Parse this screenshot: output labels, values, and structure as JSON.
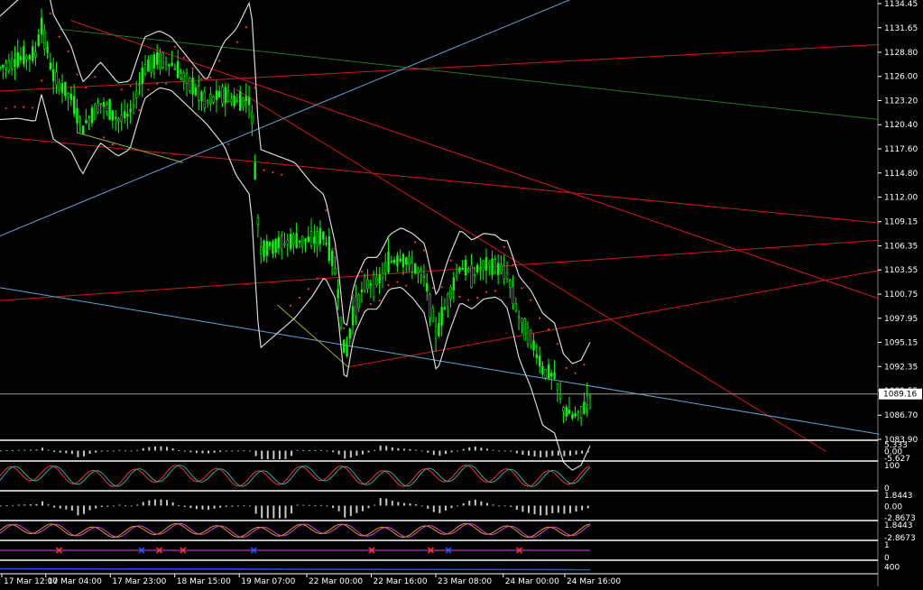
{
  "colors": {
    "background": "#000000",
    "candle": "#00ff00",
    "candle_outline": "#ffffff",
    "bands": "#d8d8d8",
    "psar": "#ff3030",
    "trend_red": "#d01818",
    "trend_blue": "#5ea6d8",
    "trend_green": "#1f7a1f",
    "trend_olive": "#a0b020",
    "trend_magenta": "#ff40a0",
    "axis_text": "#ffffff",
    "price_label_bg": "#ffffff",
    "price_label_text": "#000000",
    "osc_gray": "#c8c8c8",
    "osc_red": "#ff3030",
    "osc_teal": "#20b0b0",
    "osc_orange": "#e0a000",
    "osc_magenta": "#e040e0",
    "osc_blue": "#2050ff"
  },
  "chart_data": {
    "type": "candlestick",
    "title": "",
    "grid": false,
    "price_scale": {
      "min": 1083.9,
      "max": 1134.45,
      "ticks": [
        1134.45,
        1131.65,
        1128.8,
        1126.0,
        1123.2,
        1120.4,
        1117.6,
        1114.8,
        1112.0,
        1109.15,
        1106.35,
        1103.55,
        1100.75,
        1097.95,
        1095.15,
        1092.35,
        1089.55,
        1086.7,
        1083.9
      ],
      "current_price": 1089.16,
      "current_price_label": "1089.16"
    },
    "time_labels": [
      "17 Mar 12:00",
      "17 Mar 04:00",
      "17 Mar 23:00",
      "18 Mar 15:00",
      "19 Mar 07:00",
      "22 Mar 00:00",
      "22 Mar 16:00",
      "23 Mar 08:00",
      "24 Mar 00:00",
      "24 Mar 16:00"
    ],
    "price_path": [
      {
        "t": 0.0,
        "p": 1127.0
      },
      {
        "t": 0.03,
        "p": 1128.0
      },
      {
        "t": 0.06,
        "p": 1128.5
      },
      {
        "t": 0.07,
        "p": 1132.0
      },
      {
        "t": 0.09,
        "p": 1126.0
      },
      {
        "t": 0.12,
        "p": 1123.5
      },
      {
        "t": 0.14,
        "p": 1120.0
      },
      {
        "t": 0.17,
        "p": 1123.0
      },
      {
        "t": 0.2,
        "p": 1121.0
      },
      {
        "t": 0.22,
        "p": 1121.5
      },
      {
        "t": 0.245,
        "p": 1127.0
      },
      {
        "t": 0.27,
        "p": 1128.0
      },
      {
        "t": 0.29,
        "p": 1127.5
      },
      {
        "t": 0.31,
        "p": 1126.0
      },
      {
        "t": 0.33,
        "p": 1124.5
      },
      {
        "t": 0.35,
        "p": 1123.0
      },
      {
        "t": 0.38,
        "p": 1124.0
      },
      {
        "t": 0.4,
        "p": 1123.0
      },
      {
        "t": 0.425,
        "p": 1123.5
      },
      {
        "t": 0.44,
        "p": 1106.0
      },
      {
        "t": 0.47,
        "p": 1106.5
      },
      {
        "t": 0.5,
        "p": 1107.0
      },
      {
        "t": 0.53,
        "p": 1107.0
      },
      {
        "t": 0.55,
        "p": 1107.5
      },
      {
        "t": 0.57,
        "p": 1103.0
      },
      {
        "t": 0.585,
        "p": 1093.0
      },
      {
        "t": 0.6,
        "p": 1099.0
      },
      {
        "t": 0.62,
        "p": 1102.0
      },
      {
        "t": 0.64,
        "p": 1102.0
      },
      {
        "t": 0.66,
        "p": 1104.5
      },
      {
        "t": 0.68,
        "p": 1105.0
      },
      {
        "t": 0.7,
        "p": 1104.0
      },
      {
        "t": 0.72,
        "p": 1102.5
      },
      {
        "t": 0.74,
        "p": 1096.0
      },
      {
        "t": 0.76,
        "p": 1100.5
      },
      {
        "t": 0.78,
        "p": 1104.0
      },
      {
        "t": 0.8,
        "p": 1103.0
      },
      {
        "t": 0.82,
        "p": 1104.0
      },
      {
        "t": 0.84,
        "p": 1104.0
      },
      {
        "t": 0.86,
        "p": 1103.0
      },
      {
        "t": 0.88,
        "p": 1098.0
      },
      {
        "t": 0.9,
        "p": 1095.5
      },
      {
        "t": 0.92,
        "p": 1092.0
      },
      {
        "t": 0.94,
        "p": 1091.0
      },
      {
        "t": 0.955,
        "p": 1087.5
      },
      {
        "t": 0.97,
        "p": 1086.5
      },
      {
        "t": 0.985,
        "p": 1087.0
      },
      {
        "t": 1.0,
        "p": 1089.16
      }
    ],
    "bands_width": [
      {
        "t": 0.0,
        "w": 6.0
      },
      {
        "t": 0.07,
        "w": 8.0
      },
      {
        "t": 0.15,
        "w": 5.0
      },
      {
        "t": 0.25,
        "w": 3.5
      },
      {
        "t": 0.35,
        "w": 2.5
      },
      {
        "t": 0.43,
        "w": 12.0
      },
      {
        "t": 0.5,
        "w": 9.0
      },
      {
        "t": 0.57,
        "w": 3.0
      },
      {
        "t": 0.65,
        "w": 3.0
      },
      {
        "t": 0.75,
        "w": 4.5
      },
      {
        "t": 0.85,
        "w": 3.5
      },
      {
        "t": 0.92,
        "w": 6.5
      },
      {
        "t": 1.0,
        "w": 6.0
      }
    ],
    "trendlines": [
      {
        "color": "trend_red",
        "x1": 0.0,
        "p1": 1124.3,
        "x2": 1.49,
        "p2": 1129.7,
        "note": ""
      },
      {
        "color": "trend_red",
        "x1": 0.0,
        "p1": 1119.0,
        "x2": 1.49,
        "p2": 1109.0
      },
      {
        "color": "trend_red",
        "x1": 0.12,
        "p1": 1132.5,
        "x2": 1.49,
        "p2": 1100.2
      },
      {
        "color": "trend_red",
        "x1": 0.4,
        "p1": 1124.5,
        "x2": 1.4,
        "p2": 1082.5
      },
      {
        "color": "trend_red",
        "x1": 0.0,
        "p1": 1100.0,
        "x2": 1.49,
        "p2": 1107.0
      },
      {
        "color": "trend_red",
        "x1": 0.59,
        "p1": 1092.3,
        "x2": 1.49,
        "p2": 1103.5
      },
      {
        "color": "trend_blue",
        "x1": 0.0,
        "p1": 1101.5,
        "x2": 1.49,
        "p2": 1084.5
      },
      {
        "color": "trend_blue",
        "x1": 0.0,
        "p1": 1107.5,
        "x2": 1.04,
        "p2": 1137.0
      },
      {
        "color": "trend_green",
        "x1": 0.1,
        "p1": 1131.5,
        "x2": 1.49,
        "p2": 1121.0
      },
      {
        "color": "trend_olive",
        "x1": 0.47,
        "p1": 1099.5,
        "x2": 0.59,
        "p2": 1092.3
      },
      {
        "color": "trend_olive",
        "x1": 0.13,
        "p1": 1119.5,
        "x2": 0.31,
        "p2": 1116.0
      }
    ],
    "indicator_panels": [
      {
        "name": "macd-panel",
        "labels": [
          "5.333",
          "0.00",
          "-5.627"
        ],
        "style": "histogram"
      },
      {
        "name": "stochastic-panel",
        "labels": [
          "100",
          "0"
        ],
        "style": "lines"
      },
      {
        "name": "momentum-panel",
        "labels": [
          "1.8443",
          "0.00",
          "-2.8673"
        ],
        "style": "histogram"
      },
      {
        "name": "ma-panel",
        "labels": [
          "1.8443",
          "-2.8673"
        ],
        "style": "lines"
      },
      {
        "name": "signal-panel",
        "labels": [
          "1",
          "0"
        ],
        "style": "signals"
      },
      {
        "name": "volume-panel",
        "labels": [
          "400"
        ],
        "style": "line"
      }
    ]
  }
}
